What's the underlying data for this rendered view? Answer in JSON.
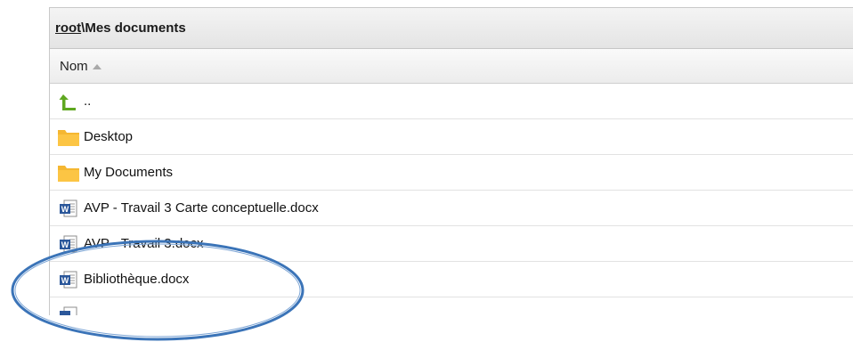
{
  "breadcrumb": {
    "root": "root",
    "separator": "\\",
    "current": "Mes documents"
  },
  "columns": {
    "name_header": "Nom",
    "sort": "ascending"
  },
  "rows": [
    {
      "label": "..",
      "icon": "up-arrow-icon"
    },
    {
      "label": "Desktop",
      "icon": "folder-icon"
    },
    {
      "label": "My Documents",
      "icon": "folder-icon"
    },
    {
      "label": "AVP - Travail 3 Carte conceptuelle.docx",
      "icon": "word-document-icon"
    },
    {
      "label": "AVP - Travail 3.docx",
      "icon": "word-document-icon"
    },
    {
      "label": "Bibliothèque.docx",
      "icon": "word-document-icon"
    }
  ],
  "highlight": {
    "target": "Bibliothèque.docx",
    "color": "#3b74b8"
  },
  "colors": {
    "folder": "#f5b731",
    "up_arrow": "#5fa820",
    "word_blue": "#2b579a"
  }
}
